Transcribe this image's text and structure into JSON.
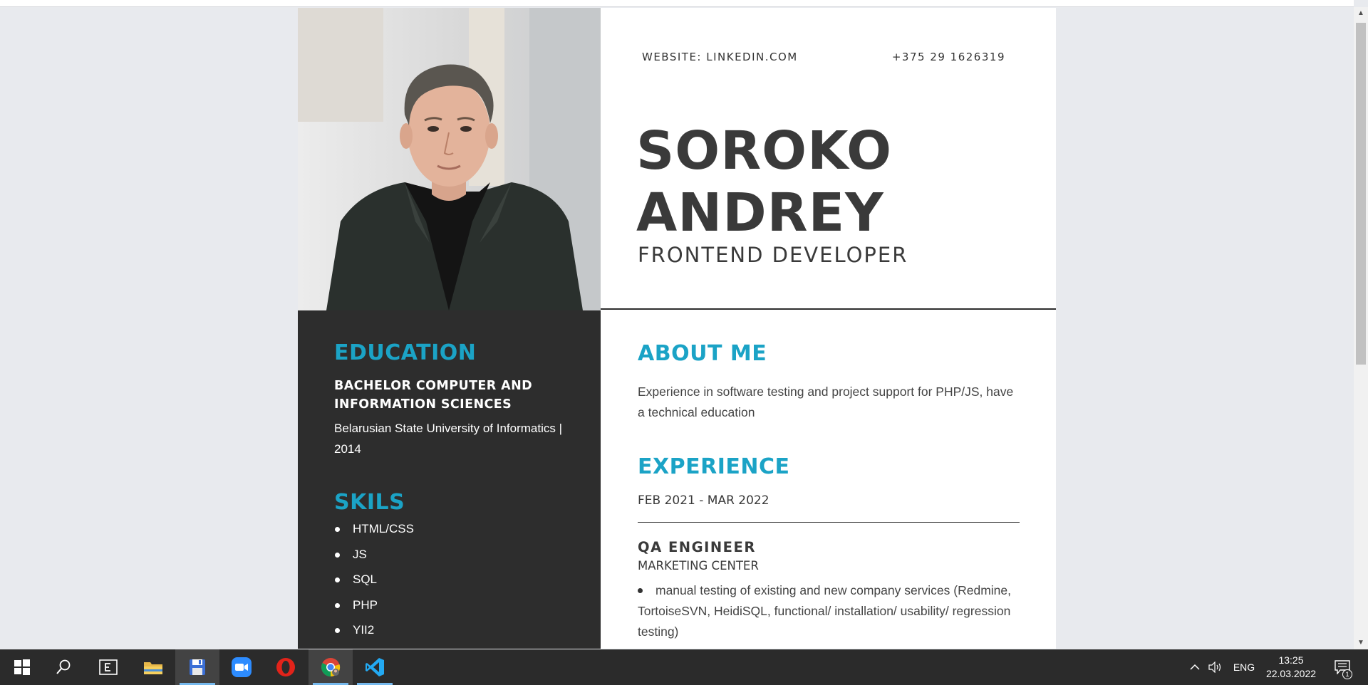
{
  "resume": {
    "contact": {
      "website": "WEBSITE: LINKEDIN.COM",
      "phone": "+375 29 1626319"
    },
    "name_line1": "SOROKO",
    "name_line2": "ANDREY",
    "role": "FRONTEND DEVELOPER",
    "education": {
      "title": "EDUCATION",
      "degree": "BACHELOR COMPUTER AND INFORMATION SCIENCES",
      "school": "Belarusian State University of Informatics | 2014"
    },
    "skills": {
      "title": "SKILS",
      "items": [
        "HTML/CSS",
        "JS",
        "SQL",
        "PHP",
        "YII2"
      ]
    },
    "about": {
      "title": "ABOUT ME",
      "text": "Experience in software testing and project support for PHP/JS, have a technical education"
    },
    "experience": {
      "title": "EXPERIENCE",
      "dates": "FEB 2021 - MAR 2022",
      "job_title": "QA ENGINEER",
      "company": "MARKETING CENTER",
      "duties": [
        "manual testing of existing and new company services (Redmine, TortoiseSVN, HeidiSQL, functional/ installation/ usability/ regression testing)"
      ]
    }
  },
  "taskbar": {
    "apps": [
      "start-icon",
      "search-icon",
      "task-view-icon",
      "file-explorer-icon",
      "save-app-icon",
      "zoom-icon",
      "opera-icon",
      "chrome-icon",
      "vscode-icon"
    ],
    "language": "ENG",
    "time": "13:25",
    "date": "22.03.2022",
    "notification_count": "1"
  },
  "colors": {
    "accent": "#1ba3c6",
    "sidebar": "#2d2d2d",
    "text": "#3a3a3a"
  }
}
